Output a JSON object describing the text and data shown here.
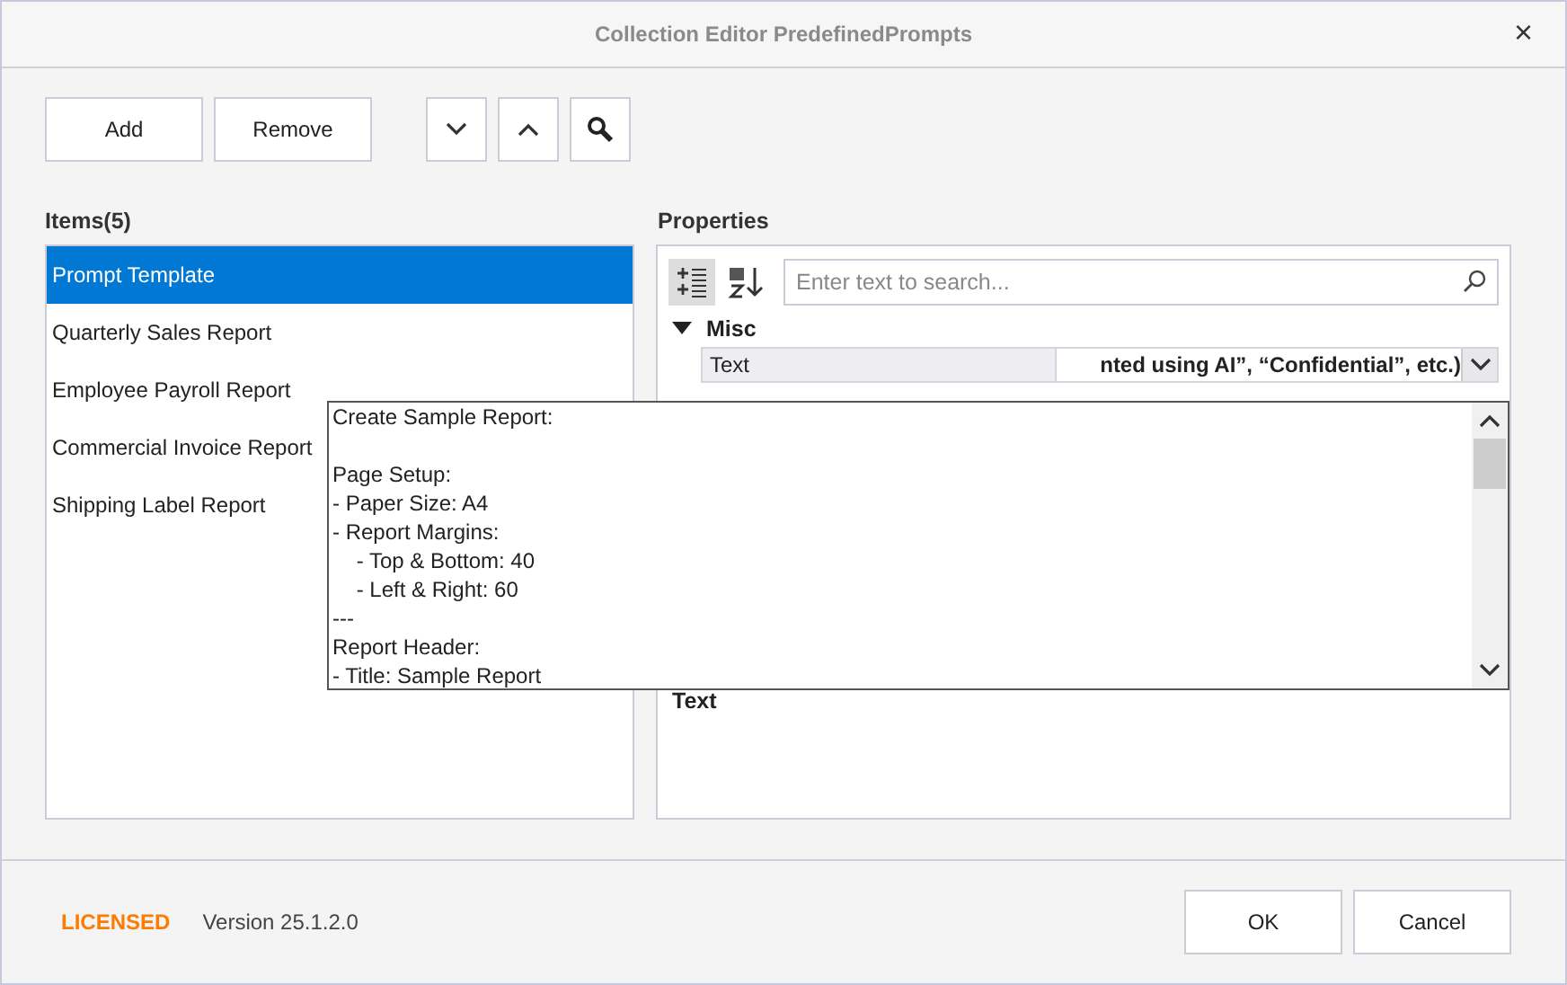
{
  "window": {
    "title": "Collection Editor PredefinedPrompts",
    "close": "×"
  },
  "toolbar": {
    "add": "Add",
    "remove": "Remove"
  },
  "items": {
    "label": "Items(5)",
    "list": [
      {
        "label": "Prompt Template",
        "selected": true
      },
      {
        "label": "Quarterly Sales Report",
        "selected": false
      },
      {
        "label": "Employee Payroll Report",
        "selected": false
      },
      {
        "label": "Commercial Invoice Report",
        "selected": false
      },
      {
        "label": "Shipping Label Report",
        "selected": false
      }
    ]
  },
  "properties": {
    "label": "Properties",
    "view_modes": [
      {
        "kind": "categorized",
        "selected": true
      },
      {
        "kind": "alphabetical",
        "selected": false
      }
    ],
    "search": {
      "placeholder": "Enter text to search..."
    },
    "category": {
      "name": "Misc",
      "expanded": true
    },
    "rows": [
      {
        "name": "Text",
        "value": "nted using AI”, “Confidential”, etc.)"
      }
    ],
    "description_title": "Text"
  },
  "dropdown": {
    "text": "Create Sample Report:\n\nPage Setup:\n- Paper Size: A4\n- Report Margins:\n    - Top & Bottom: 40\n    - Left & Right: 60\n---\nReport Header:\n- Title: Sample Report"
  },
  "footer": {
    "license": "LICENSED",
    "version": "Version 25.1.2.0",
    "ok": "OK",
    "cancel": "Cancel"
  }
}
